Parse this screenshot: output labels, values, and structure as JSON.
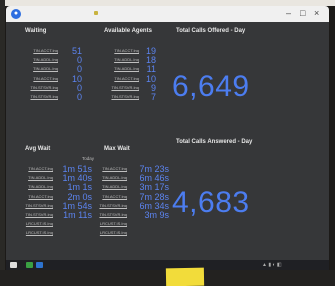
{
  "window": {
    "title": "",
    "icon": "app-logo-icon",
    "controls": [
      "–",
      "□",
      "×"
    ]
  },
  "waiting": {
    "title": "Waiting",
    "rows": [
      {
        "label": "TIN.ACCT.Inq",
        "value": "51"
      },
      {
        "label": "TIN.ADDL.Inq",
        "value": "0"
      },
      {
        "label": "TIN.ADDL.Inq",
        "value": "0"
      },
      {
        "label": "TIN.ACCT.Inq",
        "value": "10"
      },
      {
        "label": "TIN.STSVR.Inq",
        "value": "0"
      },
      {
        "label": "TIN.STSVR.Inq",
        "value": "0"
      }
    ]
  },
  "available_agents": {
    "title": "Available Agents",
    "rows": [
      {
        "label": "TIN.ACCT.Inq",
        "value": "19"
      },
      {
        "label": "TIN.ADDL.Inq",
        "value": "18"
      },
      {
        "label": "TIN.ADDL.Inq",
        "value": "11"
      },
      {
        "label": "TIN.ACCT.Inq",
        "value": "10"
      },
      {
        "label": "TIN.STSVR.Inq",
        "value": "9"
      },
      {
        "label": "TIN.STSVR.Inq",
        "value": "7"
      }
    ]
  },
  "calls_offered": {
    "title": "Total Calls Offered - Day",
    "value": "6,649"
  },
  "avg_wait": {
    "title": "Avg Wait",
    "sub_header": "Today",
    "rows": [
      {
        "label": "TIN.ACCT.Inq",
        "value": "1m 51s"
      },
      {
        "label": "TIN.ADDL.Inq",
        "value": "1m 40s"
      },
      {
        "label": "TIN.ADDL.Inq",
        "value": "1m 1s"
      },
      {
        "label": "TIN.ACCT.Inq",
        "value": "2m 0s"
      },
      {
        "label": "TIN.STSVR.Inq",
        "value": "1m 54s"
      },
      {
        "label": "TIN.STSVR.Inq",
        "value": "1m 11s"
      },
      {
        "label": "LRCUST.IS.Inq",
        "value": ""
      },
      {
        "label": "LRCUST.IS.Inq",
        "value": ""
      }
    ]
  },
  "max_wait": {
    "title": "Max Wait",
    "rows": [
      {
        "label": "TIN.ACCT.Inq",
        "value": "7m 23s"
      },
      {
        "label": "TIN.ADDL.Inq",
        "value": "6m 46s"
      },
      {
        "label": "TIN.ADDL.Inq",
        "value": "3m 17s"
      },
      {
        "label": "TIN.ACCT.Inq",
        "value": "7m 28s"
      },
      {
        "label": "TIN.STSVR.Inq",
        "value": "6m 34s"
      },
      {
        "label": "TIN.STSVR.Inq",
        "value": "3m 9s"
      },
      {
        "label": "LRCUST.IS.Inq",
        "value": ""
      },
      {
        "label": "LRCUST.IS.Inq",
        "value": ""
      }
    ]
  },
  "calls_answered": {
    "title": "Total Calls Answered - Day",
    "value": "4,683"
  },
  "colors": {
    "accent": "#4c7df0",
    "background": "#363739",
    "sticky_note": "#f2dc3a"
  }
}
